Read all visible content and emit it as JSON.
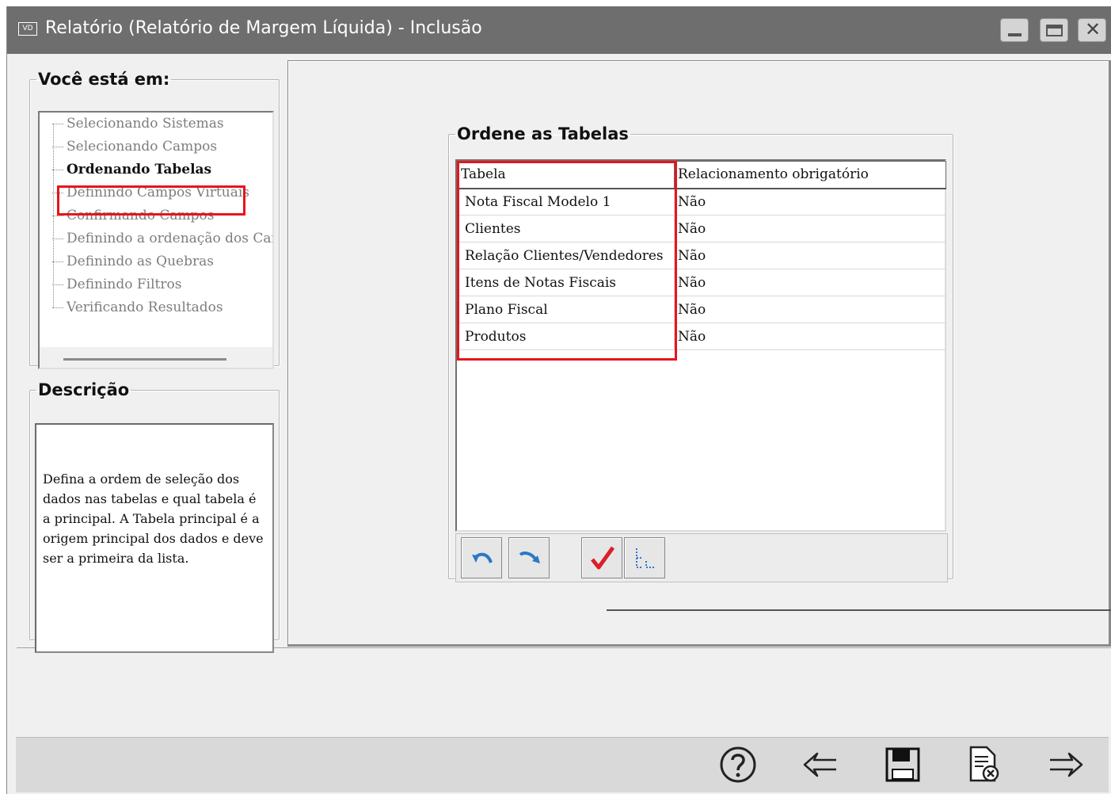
{
  "window": {
    "logo": "VD",
    "title": "Relatório (Relatório de Margem Líquida) - Inclusão"
  },
  "location_group": {
    "title": "Você está em:",
    "steps": [
      "Selecionando Sistemas",
      "Selecionando Campos",
      "Ordenando Tabelas",
      "Definindo Campos Virtuais",
      "Confirmando Campos",
      "Definindo a ordenação dos Campos",
      "Definindo as Quebras",
      "Definindo Filtros",
      "Verificando Resultados"
    ],
    "active_step": "Ordenando Tabelas"
  },
  "description_group": {
    "title": "Descrição",
    "text": "Defina a ordem de seleção dos dados nas tabelas e qual tabela é a principal. A Tabela principal é a origem principal dos dados e deve ser a primeira da lista."
  },
  "tables_group": {
    "title": "Ordene as Tabelas",
    "columns": [
      "Tabela",
      "Relacionamento obrigatório"
    ],
    "rows": [
      {
        "tabela": "Nota Fiscal Modelo 1",
        "relacionamento": "Não"
      },
      {
        "tabela": "Clientes",
        "relacionamento": "Não"
      },
      {
        "tabela": "Relação Clientes/Vendedores",
        "relacionamento": "Não"
      },
      {
        "tabela": "Itens de Notas Fiscais",
        "relacionamento": "Não"
      },
      {
        "tabela": "Plano Fiscal",
        "relacionamento": "Não"
      },
      {
        "tabela": "Produtos",
        "relacionamento": "Não"
      }
    ]
  },
  "icons": {
    "toolbar": [
      "move-up-icon",
      "move-down-icon",
      "checkmark-icon",
      "tree-icon"
    ],
    "bottom_nav": [
      "help-icon",
      "back-arrow-icon",
      "save-icon",
      "cancel-document-icon",
      "next-arrow-icon"
    ]
  },
  "colors": {
    "highlight": "#e8141e",
    "titlebar": "#6e6e6e",
    "toolbar_arrow": "#2a78c8",
    "check": "#d8202a"
  }
}
